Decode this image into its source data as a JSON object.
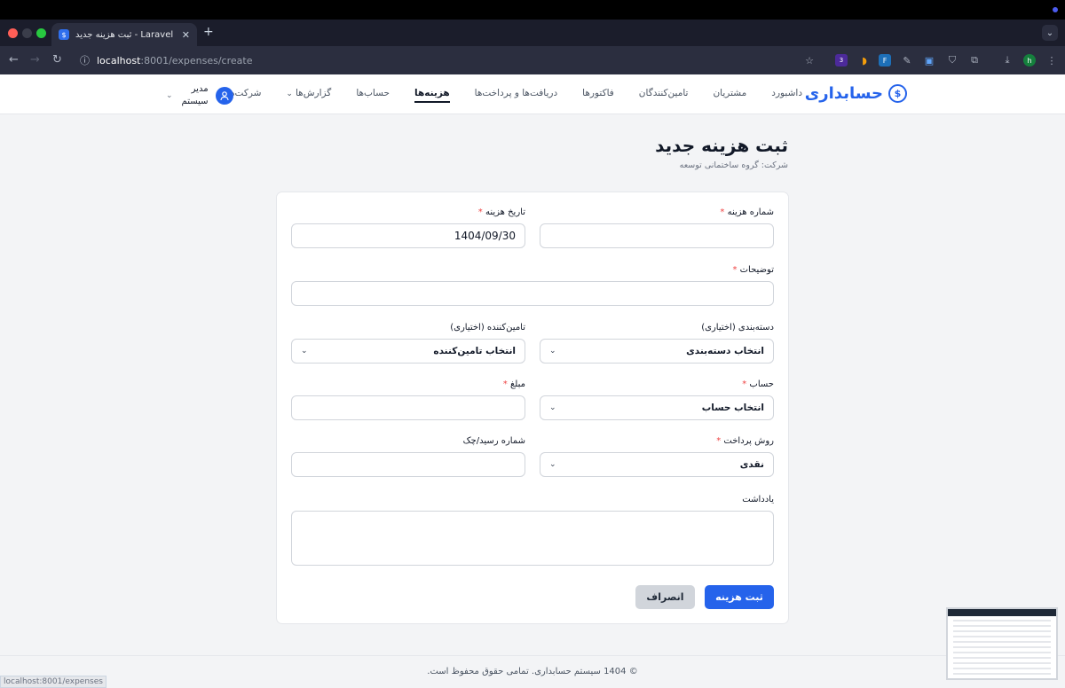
{
  "browser": {
    "tab_title": "Laravel - ثبت هزینه جدید",
    "favicon_text": "$",
    "url_host": "localhost",
    "url_path": ":8001/expenses/create",
    "status_url": "localhost:8001/expenses",
    "ext_badge_count": "3",
    "profile_initial": "h"
  },
  "nav": {
    "brand": "حسابداری",
    "brand_icon": "dollar-circle-icon",
    "links": [
      "داشبورد",
      "مشتریان",
      "تامین‌کنندگان",
      "فاکتورها",
      "دریافت‌ها و پرداخت‌ها",
      "هزینه‌ها",
      "حساب‌ها",
      "گزارش‌ها",
      "شرکت‌ها"
    ],
    "active_link": "هزینه‌ها",
    "user_name_line1": "مدیر",
    "user_name_line2": "سیستم",
    "accent_color": "#2563eb"
  },
  "page": {
    "title": "ثبت هزینه جدید",
    "company_label": "شرکت: گروه ساختمانی توسعه"
  },
  "form": {
    "expense_number": {
      "label": "شماره هزینه",
      "required": "*",
      "value": ""
    },
    "expense_date": {
      "label": "تاریخ هزینه",
      "required": "*",
      "value": "1404/09/30"
    },
    "description": {
      "label": "توضیحات",
      "required": "*",
      "value": ""
    },
    "category": {
      "label": "دسته‌بندی (اختیاری)",
      "value": "انتخاب دسته‌بندی"
    },
    "supplier": {
      "label": "تامین‌کننده (اختیاری)",
      "value": "انتخاب تامین‌کننده"
    },
    "account": {
      "label": "حساب",
      "required": "*",
      "value": "انتخاب حساب"
    },
    "amount": {
      "label": "مبلغ",
      "required": "*",
      "value": ""
    },
    "payment_method": {
      "label": "روش پرداخت",
      "required": "*",
      "value": "نقدی"
    },
    "receipt_number": {
      "label": "شماره رسید/چک",
      "value": ""
    },
    "note": {
      "label": "یادداشت",
      "value": ""
    },
    "submit_label": "ثبت هزینه",
    "cancel_label": "انصراف"
  },
  "footer": {
    "text": "© 1404 سیستم حسابداری. تمامی حقوق محفوظ است."
  }
}
